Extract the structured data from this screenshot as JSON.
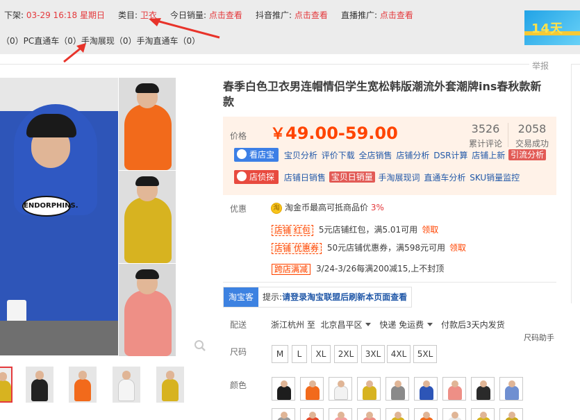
{
  "topbar": {
    "listed_label": "下架:",
    "listed_value": "03-29 16:18 星期日",
    "category_label": "类目:",
    "category_value": "卫衣",
    "today_sales_label": "今日销量:",
    "today_sales_link": "点击查看",
    "douyin_label": "抖音推广:",
    "douyin_link": "点击查看",
    "live_label": "直播推广:",
    "live_link": "点击查看",
    "row2_text_1": "（0）PC直通车（0）",
    "row2_mobile_show": "手淘展现",
    "row2_text_2": "（0）手淘直通车（0）",
    "banner_text": "14天"
  },
  "report_label": "举报",
  "product": {
    "title": "春季白色卫衣男连帽情侣学生宽松韩版潮流外套潮牌ins春秋款新款",
    "main_image_logo_text": "ENDORPHINS."
  },
  "price_section": {
    "label": "价格",
    "currency": "￥",
    "price_range": "49.00-59.00",
    "reviews_count": "3526",
    "reviews_label": "累计评论",
    "deals_count": "2058",
    "deals_label": "交易成功",
    "tool1_badge": "看店宝",
    "tool1_links": [
      "宝贝分析",
      "评价下载",
      "全店销售",
      "店铺分析",
      "DSR计算",
      "店铺上新"
    ],
    "tool1_highlight": "引流分析",
    "tool2_badge": "店侦探",
    "tool2_link_1": "店铺日销售",
    "tool2_highlight": "宝贝日销量",
    "tool2_links": [
      "手淘展现词",
      "直通车分析",
      "SKU销量监控"
    ]
  },
  "promo": {
    "label": "优惠",
    "coin_icon_text": "淘",
    "coin_text": "淘金币最高可抵商品价",
    "coin_pct": "3%",
    "coupon1_tag": "店铺 红包",
    "coupon1_text": "5元店铺红包，满5.01可用",
    "coupon1_claim": "领取",
    "coupon2_tag": "店铺 优惠券",
    "coupon2_text": "50元店铺优惠券，满598元可用",
    "coupon2_claim": "领取",
    "coupon3_tag": "跨店满减",
    "coupon3_text": "3/24-3/26每满200减15,上不封顶"
  },
  "taobaoke": {
    "tag": "淘宝客",
    "tip_label": "提示:",
    "tip_text": "请登录淘宝联盟后刷新本页面查看"
  },
  "shipping": {
    "label": "配送",
    "from": "浙江杭州 至",
    "to": "北京昌平区",
    "method": "快递 免运费",
    "promise": "付款后3天内发货"
  },
  "size": {
    "label": "尺码",
    "helper": "尺码助手",
    "options": [
      "M",
      "L",
      "XL",
      "2XL",
      "3XL",
      "4XL",
      "5XL"
    ]
  },
  "color": {
    "label": "颜色"
  },
  "colors": {
    "accent_red": "#e4393c",
    "price_orange": "#ff4400",
    "link_blue": "#2158a8",
    "price_box_bg": "#fff2e8",
    "hoodie_blue": "#2d55b7",
    "hoodie_orange": "#f26a1b",
    "hoodie_yellow": "#d7b320",
    "hoodie_pink": "#ee8f86"
  }
}
